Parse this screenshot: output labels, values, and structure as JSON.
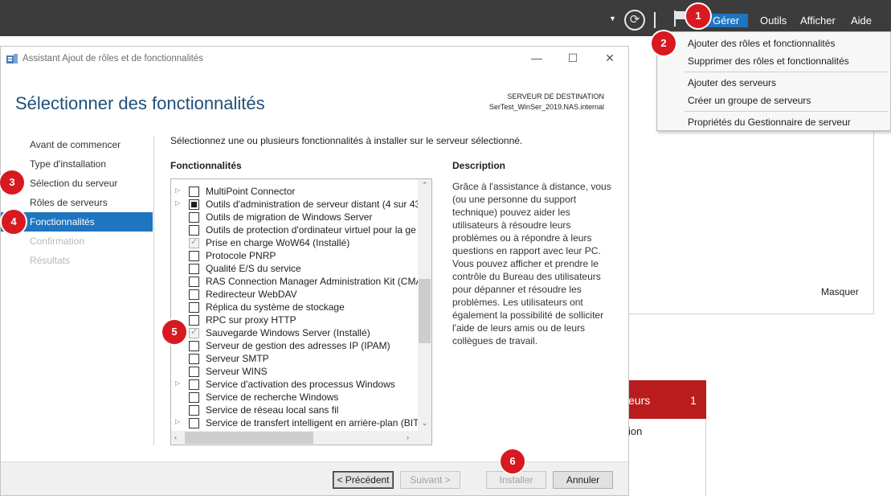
{
  "topbar": {
    "menu": [
      "Gérer",
      "Outils",
      "Afficher",
      "Aide"
    ]
  },
  "manage_menu": {
    "items": [
      "Ajouter des rôles et fonctionnalités",
      "Supprimer des rôles et fonctionnalités",
      "Ajouter des serveurs",
      "Créer un groupe de serveurs",
      "Propriétés du Gestionnaire de serveur"
    ]
  },
  "background": {
    "masquer": "Masquer",
    "red_tile_label": "eurs",
    "red_tile_count": "1",
    "tile_text": "ion"
  },
  "wizard": {
    "title": "Assistant Ajout de rôles et de fonctionnalités",
    "heading": "Sélectionner des fonctionnalités",
    "dest_label": "SERVEUR DE DESTINATION",
    "dest_value": "SerTest_WinSer_2019.NAS.internal",
    "nav": [
      {
        "label": "Avant de commencer",
        "state": "normal"
      },
      {
        "label": "Type d'installation",
        "state": "normal"
      },
      {
        "label": "Sélection du serveur",
        "state": "normal"
      },
      {
        "label": "Rôles de serveurs",
        "state": "normal"
      },
      {
        "label": "Fonctionnalités",
        "state": "active"
      },
      {
        "label": "Confirmation",
        "state": "disabled"
      },
      {
        "label": "Résultats",
        "state": "disabled"
      }
    ],
    "intro": "Sélectionnez une ou plusieurs fonctionnalités à installer sur le serveur sélectionné.",
    "features_heading": "Fonctionnalités",
    "description_heading": "Description",
    "description": "Grâce à l'assistance à distance, vous (ou une personne du support technique) pouvez aider les utilisateurs à résoudre leurs problèmes ou à répondre à leurs questions en rapport avec leur PC. Vous pouvez afficher et prendre le contrôle du Bureau des utilisateurs pour dépanner et résoudre les problèmes. Les utilisateurs ont également la possibilité de solliciter l'aide de leurs amis ou de leurs collègues de travail.",
    "features": [
      {
        "label": "MultiPoint Connector",
        "expandable": true,
        "state": "unchecked"
      },
      {
        "label": "Outils d'administration de serveur distant (4 sur 43",
        "expandable": true,
        "state": "partial"
      },
      {
        "label": "Outils de migration de Windows Server",
        "expandable": false,
        "state": "unchecked"
      },
      {
        "label": "Outils de protection d'ordinateur virtuel pour la ge",
        "expandable": false,
        "state": "unchecked"
      },
      {
        "label": "Prise en charge WoW64 (Installé)",
        "expandable": false,
        "state": "installed"
      },
      {
        "label": "Protocole PNRP",
        "expandable": false,
        "state": "unchecked"
      },
      {
        "label": "Qualité E/S du service",
        "expandable": false,
        "state": "unchecked"
      },
      {
        "label": "RAS Connection Manager Administration Kit (CMA",
        "expandable": false,
        "state": "unchecked"
      },
      {
        "label": "Redirecteur WebDAV",
        "expandable": false,
        "state": "unchecked"
      },
      {
        "label": "Réplica du système de stockage",
        "expandable": false,
        "state": "unchecked"
      },
      {
        "label": "RPC sur proxy HTTP",
        "expandable": false,
        "state": "unchecked"
      },
      {
        "label": "Sauvegarde Windows Server (Installé)",
        "expandable": false,
        "state": "installed"
      },
      {
        "label": "Serveur de gestion des adresses IP (IPAM)",
        "expandable": false,
        "state": "unchecked"
      },
      {
        "label": "Serveur SMTP",
        "expandable": false,
        "state": "unchecked"
      },
      {
        "label": "Serveur WINS",
        "expandable": false,
        "state": "unchecked"
      },
      {
        "label": "Service d'activation des processus Windows",
        "expandable": true,
        "state": "unchecked"
      },
      {
        "label": "Service de recherche Windows",
        "expandable": false,
        "state": "unchecked"
      },
      {
        "label": "Service de réseau local sans fil",
        "expandable": false,
        "state": "unchecked"
      },
      {
        "label": "Service de transfert intelligent en arrière-plan (BITS",
        "expandable": true,
        "state": "unchecked"
      }
    ],
    "buttons": {
      "previous": "< Précédent",
      "next": "Suivant >",
      "install": "Installer",
      "cancel": "Annuler"
    }
  },
  "markers": [
    "1",
    "2",
    "3",
    "4",
    "5",
    "6"
  ],
  "colors": {
    "accent": "#1e75c0",
    "marker": "#d71920",
    "topbar": "#3c3c3c",
    "heading": "#1f4e79",
    "alert_tile": "#b91c1c"
  }
}
